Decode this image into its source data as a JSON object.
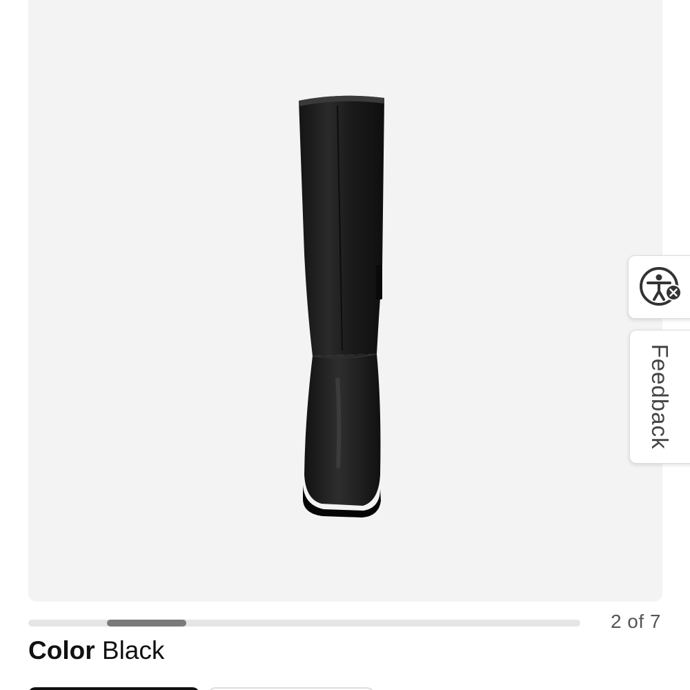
{
  "gallery": {
    "product_image": "knee-high black leather boot, front view",
    "position_text": "2 of 7",
    "current_index": 2,
    "total_images": 7,
    "background_color": "#f3f3f3"
  },
  "color": {
    "label": "Color",
    "value": "Black"
  },
  "side_tabs": {
    "accessibility_icon": "accessibility-icon",
    "feedback_label": "Feedback"
  },
  "colors": {
    "thumb": "#7a7a7a",
    "track": "#e5e5e5",
    "text": "#111111",
    "muted_text": "#555555"
  }
}
